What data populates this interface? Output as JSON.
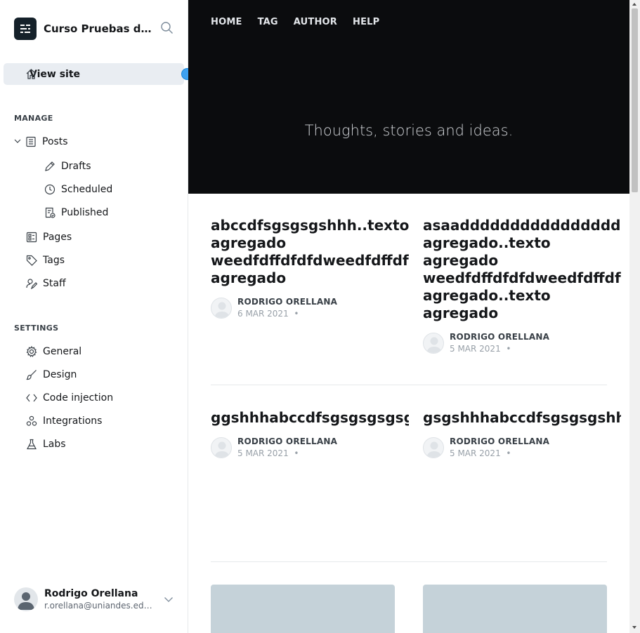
{
  "sidebar": {
    "site_title": "Curso Pruebas de Software",
    "view_site": "View site",
    "manage_title": "MANAGE",
    "items": {
      "posts": "Posts",
      "drafts": "Drafts",
      "scheduled": "Scheduled",
      "published": "Published",
      "pages": "Pages",
      "tags": "Tags",
      "staff": "Staff"
    },
    "settings_title": "SETTINGS",
    "settings": {
      "general": "General",
      "design": "Design",
      "code_injection": "Code injection",
      "integrations": "Integrations",
      "labs": "Labs"
    },
    "user": {
      "name": "Rodrigo Orellana",
      "email": "r.orellana@uniandes.edu.co"
    }
  },
  "site": {
    "nav": [
      "HOME",
      "TAG",
      "AUTHOR",
      "HELP"
    ],
    "description": "Thoughts, stories and ideas.",
    "posts": [
      {
        "title_lines": [
          "abccdfsgsgsgshhh..texto",
          "agregado",
          "weedfdffdfdfdweedfdffdfdfdfd",
          "agregado"
        ],
        "author": "RODRIGO ORELLANA",
        "date": "6 MAR 2021"
      },
      {
        "title_lines": [
          "asaaddddddddddddddddddddd",
          "agregado..texto",
          "agregado",
          "weedfdffdfdfdweedfdffdfdfdfd",
          "agregado..texto",
          "agregado"
        ],
        "author": "RODRIGO ORELLANA",
        "date": "5 MAR 2021"
      },
      {
        "title_lines": [
          "ggshhhabccdfsgsgsgsgsgshhh"
        ],
        "author": "RODRIGO ORELLANA",
        "date": "5 MAR 2021"
      },
      {
        "title_lines": [
          "gsgshhhabccdfsgsgsgshhh"
        ],
        "author": "RODRIGO ORELLANA",
        "date": "5 MAR 2021"
      }
    ],
    "meta_separator": "•"
  },
  "colors": {
    "accent_dot": "#3ea1f0",
    "hero_bg": "#0b0c0e",
    "active_nav_bg": "#e9edf2",
    "card_image": "#c5d2d9"
  }
}
